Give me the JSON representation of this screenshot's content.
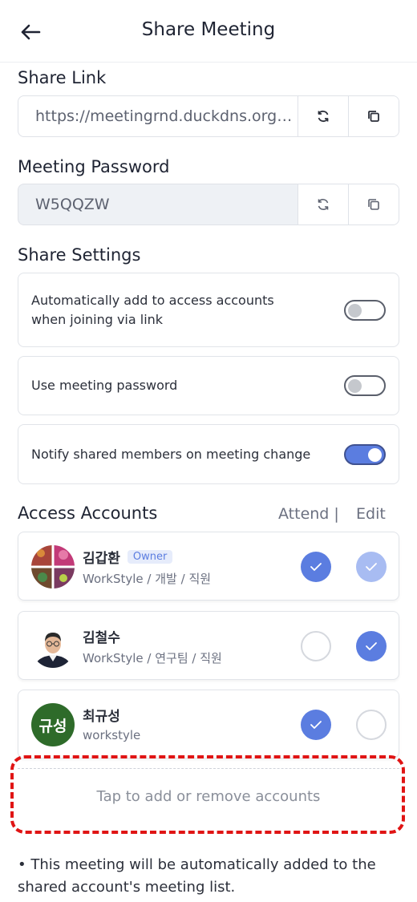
{
  "header": {
    "title": "Share Meeting",
    "back_icon": "arrow-left-icon"
  },
  "share_link": {
    "label": "Share Link",
    "value": "https://meetingrnd.duckdns.org…",
    "refresh_icon": "refresh-icon",
    "copy_icon": "copy-icon"
  },
  "meeting_password": {
    "label": "Meeting Password",
    "value": "W5QQZW",
    "refresh_icon": "refresh-icon",
    "copy_icon": "copy-icon"
  },
  "share_settings": {
    "label": "Share Settings",
    "items": [
      {
        "text": "Automatically add to access accounts when joining via link",
        "enabled": false
      },
      {
        "text": "Use meeting password",
        "enabled": false
      },
      {
        "text": "Notify shared members on meeting change",
        "enabled": true
      }
    ]
  },
  "access_accounts": {
    "label": "Access Accounts",
    "col_attend": "Attend |",
    "col_edit": "Edit",
    "members": [
      {
        "name": "김갑환",
        "badge": "Owner",
        "sub": "WorkStyle / 개발 / 직원",
        "attend": true,
        "edit": true,
        "edit_locked": true
      },
      {
        "name": "김철수",
        "badge": "",
        "sub": "WorkStyle / 연구팀 / 직원",
        "attend": false,
        "edit": true,
        "edit_locked": false
      },
      {
        "name": "최규성",
        "badge": "",
        "sub": "workstyle",
        "avatar_text": "규성",
        "attend": true,
        "edit": false,
        "edit_locked": false
      }
    ],
    "add_text": "Tap to add or remove accounts"
  },
  "note": "• This meeting will be automatically added to the shared account's meeting list.",
  "colors": {
    "accent": "#5b7de0",
    "accent_light": "#a8bcf2",
    "highlight": "#e01414",
    "avatar_green": "#2e6b2a"
  }
}
